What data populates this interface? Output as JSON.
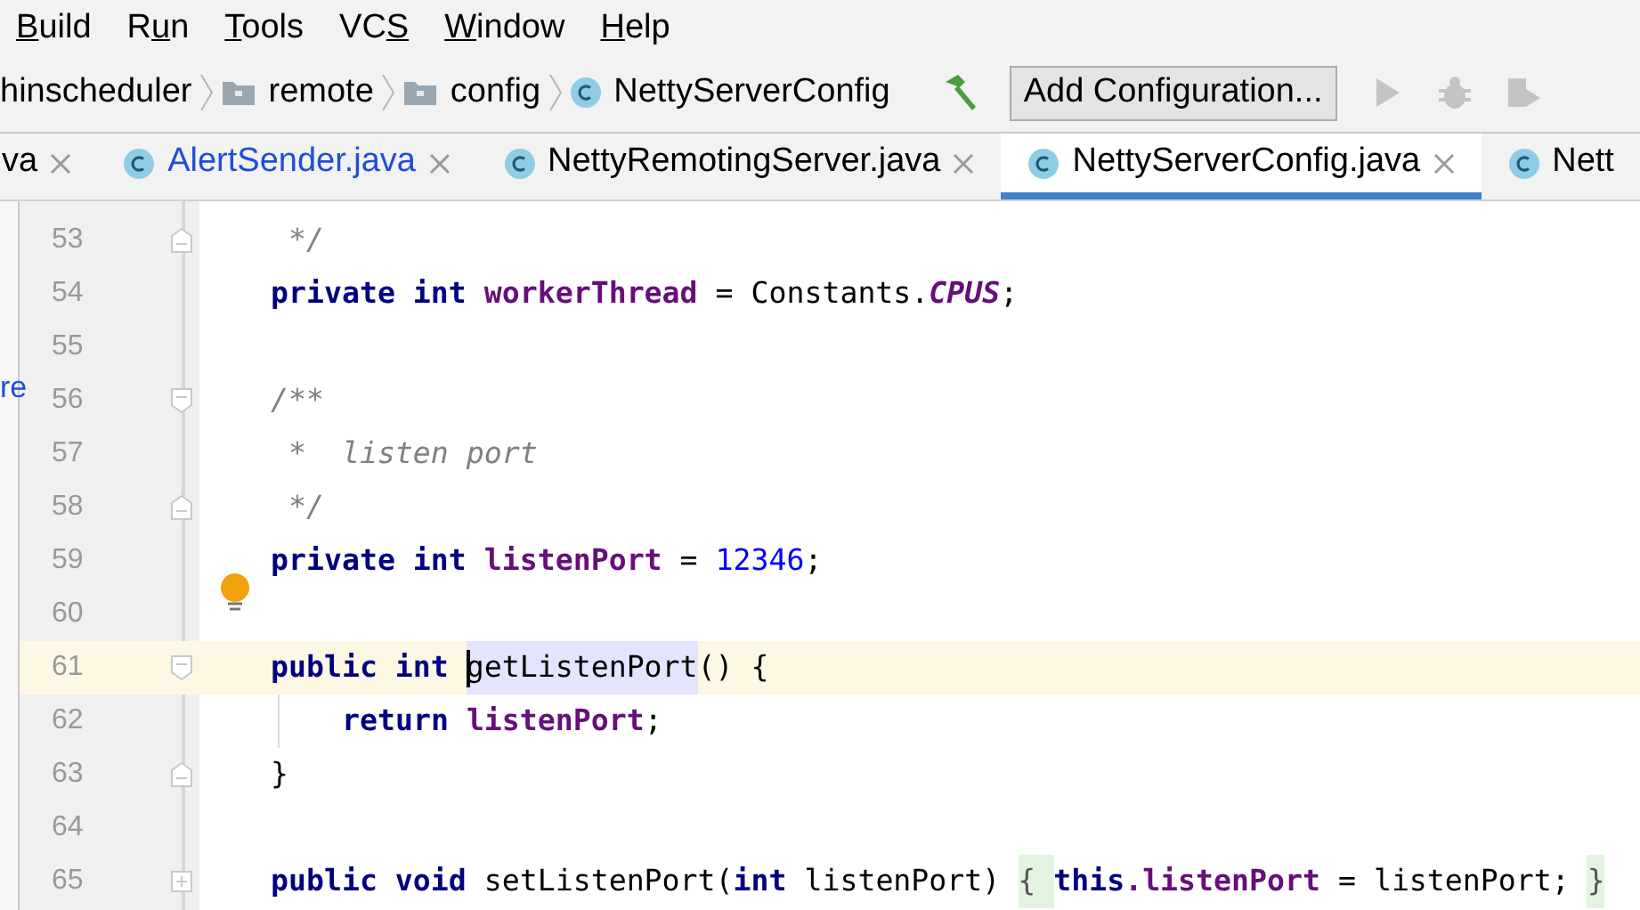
{
  "menu": [
    {
      "key": "B",
      "post": "uild"
    },
    {
      "pre": "R",
      "key": "u",
      "post": "n"
    },
    {
      "key": "T",
      "post": "ools"
    },
    {
      "pre": "VC",
      "key": "S"
    },
    {
      "key": "W",
      "post": "indow"
    },
    {
      "key": "H",
      "post": "elp"
    }
  ],
  "breadcrumbs": [
    {
      "kind": "text",
      "label": "hinscheduler"
    },
    {
      "kind": "folder",
      "label": "remote"
    },
    {
      "kind": "folder",
      "label": "config"
    },
    {
      "kind": "class",
      "label": "NettyServerConfig"
    }
  ],
  "run_configuration": {
    "label": "Add Configuration..."
  },
  "tabs": [
    {
      "label": "va",
      "class_icon": false,
      "modified": false,
      "closable": true,
      "selected": false
    },
    {
      "label": "AlertSender.java",
      "class_icon": true,
      "modified": true,
      "closable": true,
      "selected": false
    },
    {
      "label": "NettyRemotingServer.java",
      "class_icon": true,
      "modified": false,
      "closable": true,
      "selected": false
    },
    {
      "label": "NettyServerConfig.java",
      "class_icon": true,
      "modified": false,
      "closable": true,
      "selected": true
    },
    {
      "label": "Nett",
      "class_icon": true,
      "modified": false,
      "closable": false,
      "selected": false
    }
  ],
  "side_panel": {
    "fragment": "re"
  },
  "lines": [
    {
      "number": "53",
      "fold_start": false,
      "fold_end": true,
      "fold_collapsed": false,
      "current": false,
      "bulb": false,
      "nested": false,
      "tokens": [
        {
          "kind": "comment",
          "text": " */"
        }
      ]
    },
    {
      "number": "54",
      "fold_start": false,
      "fold_end": false,
      "fold_collapsed": false,
      "current": false,
      "bulb": false,
      "nested": false,
      "tokens": [
        {
          "kind": "kw",
          "text": "private int "
        },
        {
          "kind": "field",
          "text": "workerThread"
        },
        {
          "kind": "text",
          "text": " = Constants."
        },
        {
          "kind": "static",
          "text": "CPUS"
        },
        {
          "kind": "text",
          "text": ";"
        }
      ]
    },
    {
      "number": "55",
      "fold_start": false,
      "fold_end": false,
      "fold_collapsed": false,
      "current": false,
      "bulb": false
    },
    {
      "number": "56",
      "fold_start": true,
      "fold_end": false,
      "fold_collapsed": false,
      "current": false,
      "bulb": false,
      "nested": false,
      "tokens": [
        {
          "kind": "comment",
          "text": "/**"
        }
      ]
    },
    {
      "number": "57",
      "fold_start": false,
      "fold_end": false,
      "fold_collapsed": false,
      "current": false,
      "bulb": false,
      "nested": false,
      "tokens": [
        {
          "kind": "comment",
          "text": " *  listen port"
        }
      ]
    },
    {
      "number": "58",
      "fold_start": false,
      "fold_end": true,
      "fold_collapsed": false,
      "current": false,
      "bulb": false,
      "nested": false,
      "tokens": [
        {
          "kind": "comment",
          "text": " */"
        }
      ]
    },
    {
      "number": "59",
      "fold_start": false,
      "fold_end": false,
      "fold_collapsed": false,
      "current": false,
      "bulb": false,
      "nested": false,
      "tokens": [
        {
          "kind": "kw",
          "text": "private int "
        },
        {
          "kind": "field",
          "text": "listenPort"
        },
        {
          "kind": "text",
          "text": " = "
        },
        {
          "kind": "num",
          "text": "12346"
        },
        {
          "kind": "text",
          "text": ";"
        }
      ]
    },
    {
      "number": "60",
      "fold_start": false,
      "fold_end": false,
      "fold_collapsed": false,
      "current": false,
      "bulb": true
    },
    {
      "number": "61",
      "fold_start": true,
      "fold_end": false,
      "fold_collapsed": false,
      "current": true,
      "bulb": false,
      "nested": false,
      "tokens": [
        {
          "kind": "kw",
          "text": "public int "
        },
        {
          "kind": "selected",
          "text": "getListenPort",
          "caret": true
        },
        {
          "kind": "text",
          "text": "() {"
        }
      ]
    },
    {
      "number": "62",
      "fold_start": false,
      "fold_end": false,
      "fold_collapsed": false,
      "current": false,
      "bulb": false,
      "nested": true,
      "tokens": [
        {
          "kind": "kw",
          "text": "return "
        },
        {
          "kind": "field",
          "text": "listenPort"
        },
        {
          "kind": "text",
          "text": ";"
        }
      ]
    },
    {
      "number": "63",
      "fold_start": false,
      "fold_end": true,
      "fold_collapsed": false,
      "current": false,
      "bulb": false,
      "nested": false,
      "tokens": [
        {
          "kind": "text",
          "text": "}"
        }
      ]
    },
    {
      "number": "64",
      "fold_start": false,
      "fold_end": false,
      "fold_collapsed": false,
      "current": false,
      "bulb": false
    },
    {
      "number": "65",
      "fold_start": false,
      "fold_end": false,
      "fold_collapsed": true,
      "current": false,
      "bulb": false,
      "nested": false,
      "tokens": [
        {
          "kind": "kw",
          "text": "public void "
        },
        {
          "kind": "text",
          "text": "setListenPort("
        },
        {
          "kind": "kw",
          "text": "int "
        },
        {
          "kind": "text",
          "text": "listenPort) "
        },
        {
          "kind": "folded",
          "text": "{ "
        },
        {
          "kind": "kw",
          "text": "this"
        },
        {
          "kind": "field",
          "text": ".listenPort"
        },
        {
          "kind": "text",
          "text": " = listenPort; "
        },
        {
          "kind": "folded",
          "text": "}"
        }
      ]
    }
  ]
}
